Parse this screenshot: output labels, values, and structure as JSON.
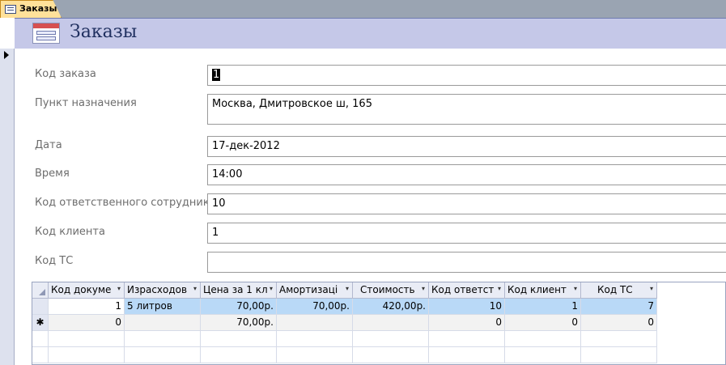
{
  "tab": {
    "label": "Заказы"
  },
  "form": {
    "title": "Заказы"
  },
  "fields": [
    {
      "label": "Код заказа",
      "value": "1"
    },
    {
      "label": "Пункт назначения",
      "value": "Москва, Дмитровское ш, 165"
    },
    {
      "label": "Дата",
      "value": "17-дек-2012"
    },
    {
      "label": "Время",
      "value": "14:00"
    },
    {
      "label": "Код ответственного сотрудника",
      "value": "10"
    },
    {
      "label": "Код клиента",
      "value": "1"
    },
    {
      "label": "Код ТС",
      "value": ""
    }
  ],
  "subform": {
    "columns": [
      "Код докуме",
      "Израсходов",
      "Цена за 1 кл",
      "Амортизаці",
      "Стоимость",
      "Код ответст",
      "Код клиент",
      "Код ТС"
    ],
    "rows": [
      [
        "1",
        "5 литров",
        "70,00р.",
        "70,00р.",
        "420,00р.",
        "10",
        "1",
        "7"
      ],
      [
        "0",
        "",
        "70,00р.",
        "",
        "",
        "0",
        "0",
        "0"
      ]
    ],
    "new_record_marker": "✱",
    "dropdown_glyph": "▾"
  }
}
